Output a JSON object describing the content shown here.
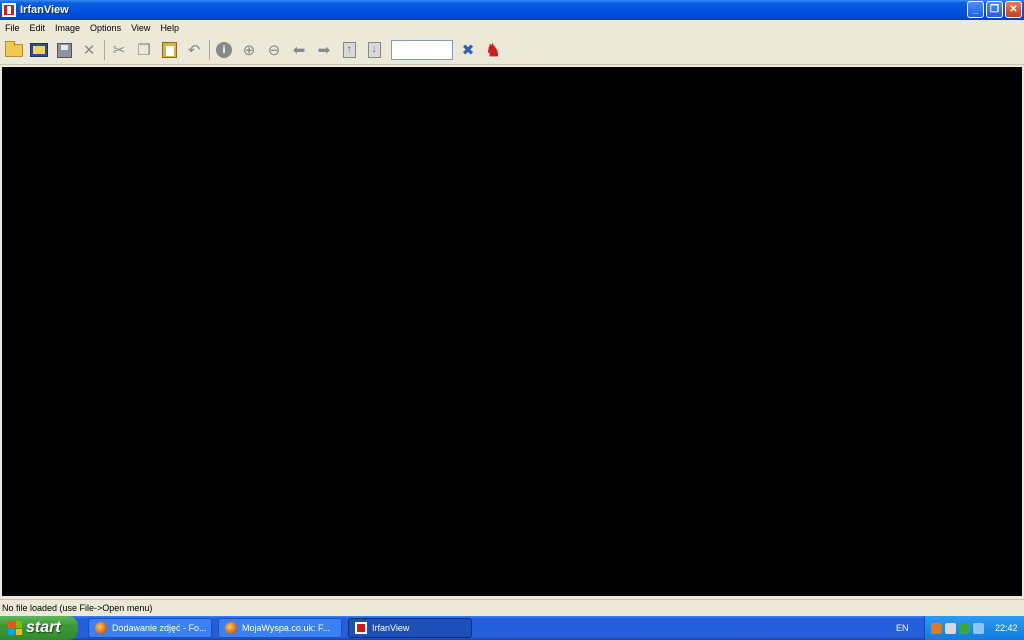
{
  "window": {
    "title": "IrfanView",
    "controls": {
      "minimize": "_",
      "maximize": "❐",
      "close": "✕"
    }
  },
  "menu": [
    "File",
    "Edit",
    "Image",
    "Options",
    "View",
    "Help"
  ],
  "toolbar": {
    "buttons": [
      "open-folder-icon",
      "slideshow-icon",
      "save-icon",
      "delete-icon",
      "cut-icon",
      "copy-icon",
      "paste-icon",
      "undo-icon",
      "info-icon",
      "zoom-in-icon",
      "zoom-out-icon",
      "prev-arrow-icon",
      "next-arrow-icon",
      "first-page-icon",
      "last-page-icon",
      "settings-icon",
      "irfanview-logo-icon"
    ],
    "zoom_value": ""
  },
  "statusbar": {
    "text": "No file loaded (use File->Open menu)"
  },
  "taskbar": {
    "start_label": "start",
    "tasks": [
      {
        "label": "Dodawanie zdjęć - Fo...",
        "icon": "firefox-icon",
        "active": false
      },
      {
        "label": "MojaWyspa.co.uk: F...",
        "icon": "firefox-icon",
        "active": false
      },
      {
        "label": "IrfanView",
        "icon": "irfanview-icon",
        "active": true
      }
    ],
    "language": "EN",
    "clock": "22:42"
  },
  "colors": {
    "titlebar": "#0053e0",
    "canvas": "#000000",
    "chrome": "#ece9d8",
    "start_green": "#3c9a3a"
  }
}
